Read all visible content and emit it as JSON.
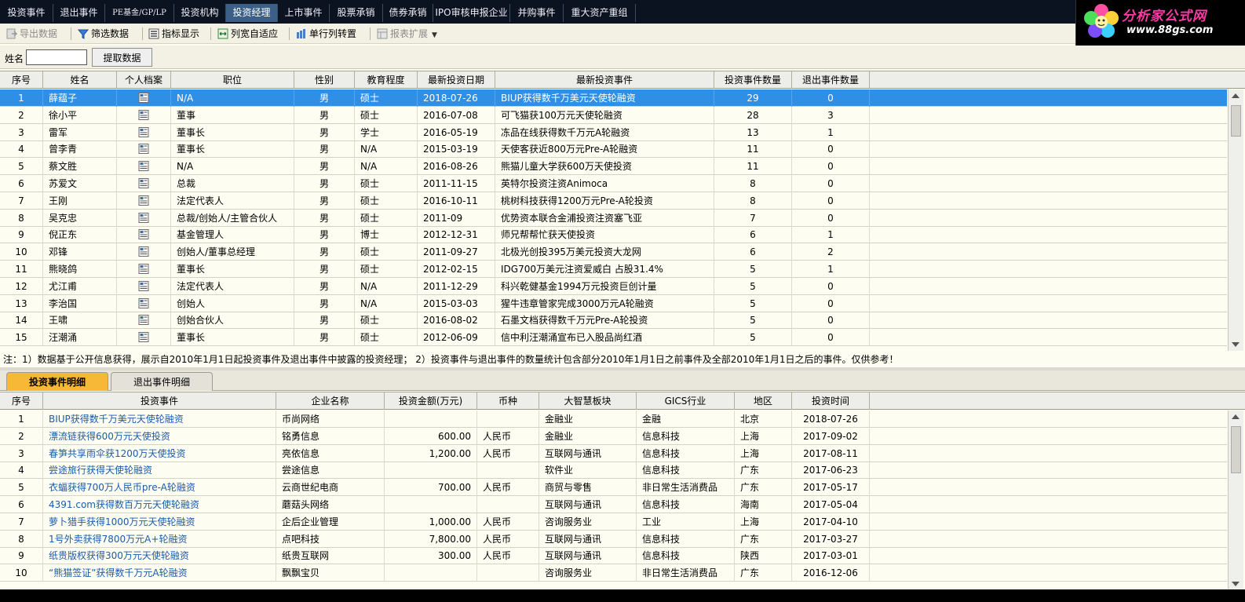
{
  "top_tabs": [
    {
      "label": "投资事件",
      "active": false
    },
    {
      "label": "退出事件",
      "active": false
    },
    {
      "label": "PE基金/GP/LP",
      "active": false
    },
    {
      "label": "投资机构",
      "active": false
    },
    {
      "label": "投资经理",
      "active": true
    },
    {
      "label": "上市事件",
      "active": false
    },
    {
      "label": "股票承销",
      "active": false
    },
    {
      "label": "债券承销",
      "active": false
    },
    {
      "label": "IPO审核申报企业",
      "active": false
    },
    {
      "label": "并购事件",
      "active": false
    },
    {
      "label": "重大资产重组",
      "active": false
    }
  ],
  "logo": {
    "brand": "分析家公式网",
    "url": "www.88gs.com"
  },
  "toolbar": {
    "export": "导出数据",
    "filter": "筛选数据",
    "indicator": "指标显示",
    "autofit": "列宽自适应",
    "transpose": "单行列转置",
    "report_ext": "报表扩展"
  },
  "search": {
    "label": "姓名",
    "value": "",
    "button": "提取数据"
  },
  "managers_table": {
    "headers": [
      "序号",
      "姓名",
      "个人档案",
      "职位",
      "性别",
      "教育程度",
      "最新投资日期",
      "最新投资事件",
      "投资事件数量",
      "退出事件数量"
    ],
    "rows": [
      [
        "1",
        "薛蕴子",
        "",
        "N/A",
        "男",
        "硕士",
        "2018-07-26",
        "BIUP获得数千万美元天使轮融资",
        "29",
        "0"
      ],
      [
        "2",
        "徐小平",
        "",
        "董事",
        "男",
        "硕士",
        "2016-07-08",
        "可飞猫获100万元天使轮融资",
        "28",
        "3"
      ],
      [
        "3",
        "雷军",
        "",
        "董事长",
        "男",
        "学士",
        "2016-05-19",
        "冻品在线获得数千万元A轮融资",
        "13",
        "1"
      ],
      [
        "4",
        "曾李青",
        "",
        "董事长",
        "男",
        "N/A",
        "2015-03-19",
        "天使客获近800万元Pre-A轮融资",
        "11",
        "0"
      ],
      [
        "5",
        "蔡文胜",
        "",
        "N/A",
        "男",
        "N/A",
        "2016-08-26",
        "熊猫儿童大学获600万天使投资",
        "11",
        "0"
      ],
      [
        "6",
        "苏爱文",
        "",
        "总裁",
        "男",
        "硕士",
        "2011-11-15",
        "英特尔投资注资Animoca",
        "8",
        "0"
      ],
      [
        "7",
        "王刚",
        "",
        "法定代表人",
        "男",
        "硕士",
        "2016-10-11",
        "桃树科技获得1200万元Pre-A轮投资",
        "8",
        "0"
      ],
      [
        "8",
        "吴克忠",
        "",
        "总裁/创始人/主管合伙人",
        "男",
        "硕士",
        "2011-09",
        "优势资本联合金浦投资注资塞飞亚",
        "7",
        "0"
      ],
      [
        "9",
        "倪正东",
        "",
        "基金管理人",
        "男",
        "博士",
        "2012-12-31",
        "师兄帮帮忙获天使投资",
        "6",
        "1"
      ],
      [
        "10",
        "邓锋",
        "",
        "创始人/董事总经理",
        "男",
        "硕士",
        "2011-09-27",
        "北极光创投395万美元投资大龙网",
        "6",
        "2"
      ],
      [
        "11",
        "熊晓鸽",
        "",
        "董事长",
        "男",
        "硕士",
        "2012-02-15",
        "IDG700万美元注资爱威白 占股31.4%",
        "5",
        "1"
      ],
      [
        "12",
        "尤江甫",
        "",
        "法定代表人",
        "男",
        "N/A",
        "2011-12-29",
        "科兴乾健基金1994万元投资巨创计量",
        "5",
        "0"
      ],
      [
        "13",
        "李治国",
        "",
        "创始人",
        "男",
        "N/A",
        "2015-03-03",
        "猩牛违章管家完成3000万元A轮融资",
        "5",
        "0"
      ],
      [
        "14",
        "王啸",
        "",
        "创始合伙人",
        "男",
        "硕士",
        "2016-08-02",
        "石墨文档获得数千万元Pre-A轮投资",
        "5",
        "0"
      ],
      [
        "15",
        "汪潮涌",
        "",
        "董事长",
        "男",
        "硕士",
        "2012-06-09",
        "信中利汪潮涌宣布已入股品尚红酒",
        "5",
        "0"
      ]
    ]
  },
  "note": "注：1）数据基于公开信息获得，展示自2010年1月1日起投资事件及退出事件中披露的投资经理；  2）投资事件与退出事件的数量统计包含部分2010年1月1日之前事件及全部2010年1月1日之后的事件。仅供参考！",
  "detail_tabs": [
    {
      "label": "投资事件明细",
      "active": true
    },
    {
      "label": "退出事件明细",
      "active": false
    }
  ],
  "details_table": {
    "headers": [
      "序号",
      "投资事件",
      "企业名称",
      "投资金额(万元)",
      "币种",
      "大智慧板块",
      "GICS行业",
      "地区",
      "投资时间"
    ],
    "rows": [
      [
        "1",
        "BIUP获得数千万美元天使轮融资",
        "币尚网络",
        "",
        "",
        "金融业",
        "金融",
        "北京",
        "2018-07-26"
      ],
      [
        "2",
        "漂流链获得600万元天使投资",
        "铭勇信息",
        "600.00",
        "人民币",
        "金融业",
        "信息科技",
        "上海",
        "2017-09-02"
      ],
      [
        "3",
        "春笋共享雨伞获1200万天使投资",
        "亮依信息",
        "1,200.00",
        "人民币",
        "互联网与通讯",
        "信息科技",
        "上海",
        "2017-08-11"
      ],
      [
        "4",
        "尝途旅行获得天使轮融资",
        "尝途信息",
        "",
        "",
        "软件业",
        "信息科技",
        "广东",
        "2017-06-23"
      ],
      [
        "5",
        "衣蝠获得700万人民币pre-A轮融资",
        "云商世纪电商",
        "700.00",
        "人民币",
        "商贸与零售",
        "非日常生活消费品",
        "广东",
        "2017-05-17"
      ],
      [
        "6",
        "4391.com获得数百万元天使轮融资",
        "蘑菇头网络",
        "",
        "",
        "互联网与通讯",
        "信息科技",
        "海南",
        "2017-05-04"
      ],
      [
        "7",
        "萝卜猎手获得1000万元天使轮融资",
        "企后企业管理",
        "1,000.00",
        "人民币",
        "咨询服务业",
        "工业",
        "上海",
        "2017-04-10"
      ],
      [
        "8",
        "1号外卖获得7800万元A+轮融资",
        "点吧科技",
        "7,800.00",
        "人民币",
        "互联网与通讯",
        "信息科技",
        "广东",
        "2017-03-27"
      ],
      [
        "9",
        "纸贵版权获得300万元天使轮融资",
        "纸贵互联网",
        "300.00",
        "人民币",
        "互联网与通讯",
        "信息科技",
        "陕西",
        "2017-03-01"
      ],
      [
        "10",
        "“熊猫签证”获得数千万元A轮融资",
        "飘飘宝贝",
        "",
        "",
        "咨询服务业",
        "非日常生活消费品",
        "广东",
        "2016-12-06"
      ]
    ]
  },
  "colors": {
    "selected_row": "#2f8fe6",
    "active_tab": "#3b5f86",
    "active_subtab": "#f6b836",
    "link": "#1a5cab",
    "background": "#fefdf1"
  },
  "icons": [
    "export-icon",
    "filter-icon",
    "indicator-icon",
    "autofit-icon",
    "transpose-icon",
    "report-icon",
    "document-icon",
    "flower-logo-icon"
  ]
}
